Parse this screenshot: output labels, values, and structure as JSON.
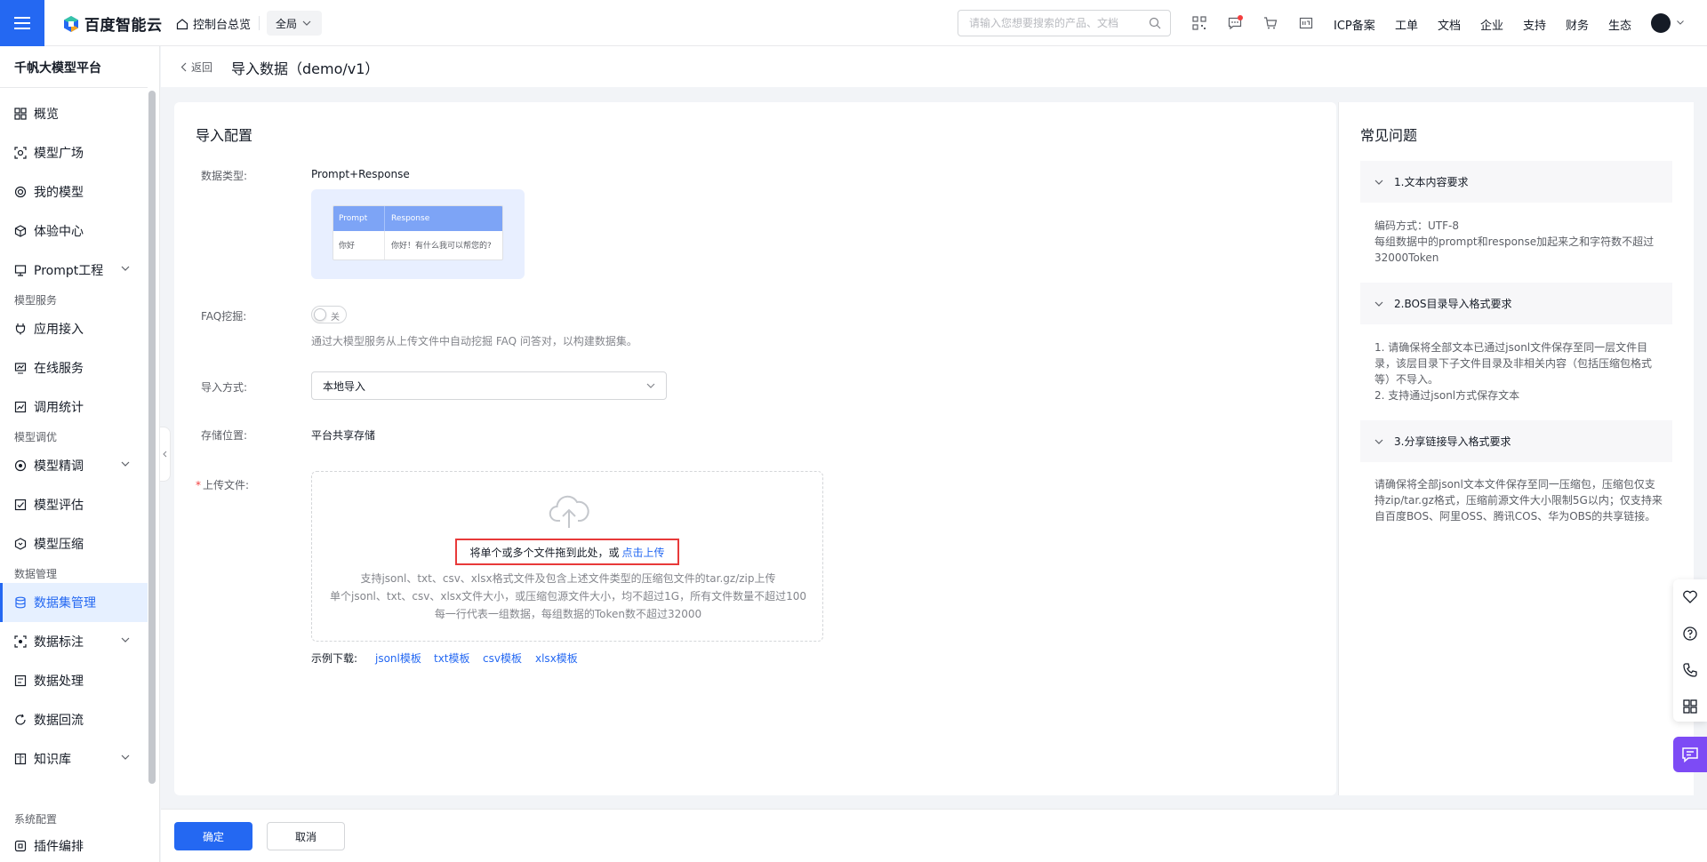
{
  "topnav": {
    "brand": "百度智能云",
    "console_label": "控制台总览",
    "region": "全局",
    "search_placeholder": "请输入您想要搜索的产品、文档",
    "links": [
      "ICP备案",
      "工单",
      "文档",
      "企业",
      "支持",
      "财务",
      "生态"
    ],
    "accent_color": "#2468f2"
  },
  "sidebar": {
    "title": "千帆大模型平台",
    "items": [
      {
        "label": "概览",
        "icon": "grid-icon"
      },
      {
        "label": "模型广场",
        "icon": "scan-icon"
      },
      {
        "label": "我的模型",
        "icon": "model-icon"
      },
      {
        "label": "体验中心",
        "icon": "cube-icon"
      },
      {
        "label": "Prompt工程",
        "icon": "prompt-icon",
        "expandable": true
      },
      {
        "group": "模型服务"
      },
      {
        "label": "应用接入",
        "icon": "plug-icon"
      },
      {
        "label": "在线服务",
        "icon": "monitor-icon"
      },
      {
        "label": "调用统计",
        "icon": "chart-icon"
      },
      {
        "group": "模型调优"
      },
      {
        "label": "模型精调",
        "icon": "tune-icon",
        "expandable": true
      },
      {
        "label": "模型评估",
        "icon": "evaluate-icon"
      },
      {
        "label": "模型压缩",
        "icon": "compress-icon"
      },
      {
        "group": "数据管理"
      },
      {
        "label": "数据集管理",
        "icon": "database-icon",
        "active": true
      },
      {
        "label": "数据标注",
        "icon": "annotate-icon",
        "expandable": true
      },
      {
        "label": "数据处理",
        "icon": "process-icon"
      },
      {
        "label": "数据回流",
        "icon": "reflow-icon"
      },
      {
        "label": "知识库",
        "icon": "book-icon",
        "expandable": true
      },
      {
        "group": "系统配置"
      },
      {
        "label": "插件编排",
        "icon": "plugin-icon"
      }
    ]
  },
  "page": {
    "back_label": "返回",
    "title": "导入数据（demo/v1）"
  },
  "form": {
    "section_title": "导入配置",
    "data_type_label": "数据类型:",
    "data_type_value": "Prompt+Response",
    "preview": {
      "head_prompt": "Prompt",
      "head_response": "Response",
      "row_prompt": "你好",
      "row_response": "你好！有什么我可以帮您的?"
    },
    "faq_label": "FAQ挖掘:",
    "faq_toggle_text": "关",
    "faq_help": "通过大模型服务从上传文件中自动挖掘 FAQ 问答对，以构建数据集。",
    "import_method_label": "导入方式:",
    "import_method_value": "本地导入",
    "storage_label": "存储位置:",
    "storage_value": "平台共享存储",
    "upload_label": "上传文件:",
    "upload_main_text": "将单个或多个文件拖到此处，或",
    "upload_link": "点击上传",
    "upload_tips": [
      "支持jsonl、txt、csv、xlsx格式文件及包含上述文件类型的压缩包文件的tar.gz/zip上传",
      "单个jsonl、txt、csv、xlsx文件大小，或压缩包源文件大小，均不超过1G，所有文件数量不超过100",
      "每一行代表一组数据，每组数据的Token数不超过32000"
    ],
    "template_label": "示例下载:",
    "templates": [
      "jsonl模板",
      "txt模板",
      "csv模板",
      "xlsx模板"
    ]
  },
  "faq": {
    "title": "常见问题",
    "items": [
      {
        "head": "1.文本内容要求",
        "lines": [
          "编码方式：UTF-8",
          "每组数据中的prompt和response加起来之和字符数不超过",
          "32000Token"
        ]
      },
      {
        "head": "2.BOS目录导入格式要求",
        "lines": [
          "1. 请确保将全部文本已通过jsonl文件保存至同一层文件目",
          "录，该层目录下子文件目录及非相关内容（包括压缩包格式",
          "等）不导入。",
          "2. 支持通过jsonl方式保存文本"
        ]
      },
      {
        "head": "3.分享链接导入格式要求",
        "lines": [
          "请确保将全部jsonl文本文件保存至同一压缩包，压缩包仅支",
          "持zip/tar.gz格式，压缩前源文件大小限制5G以内；仅支持来",
          "自百度BOS、阿里OSS、腾讯COS、华为OBS的共享链接。"
        ]
      }
    ]
  },
  "footer": {
    "confirm": "确定",
    "cancel": "取消"
  }
}
